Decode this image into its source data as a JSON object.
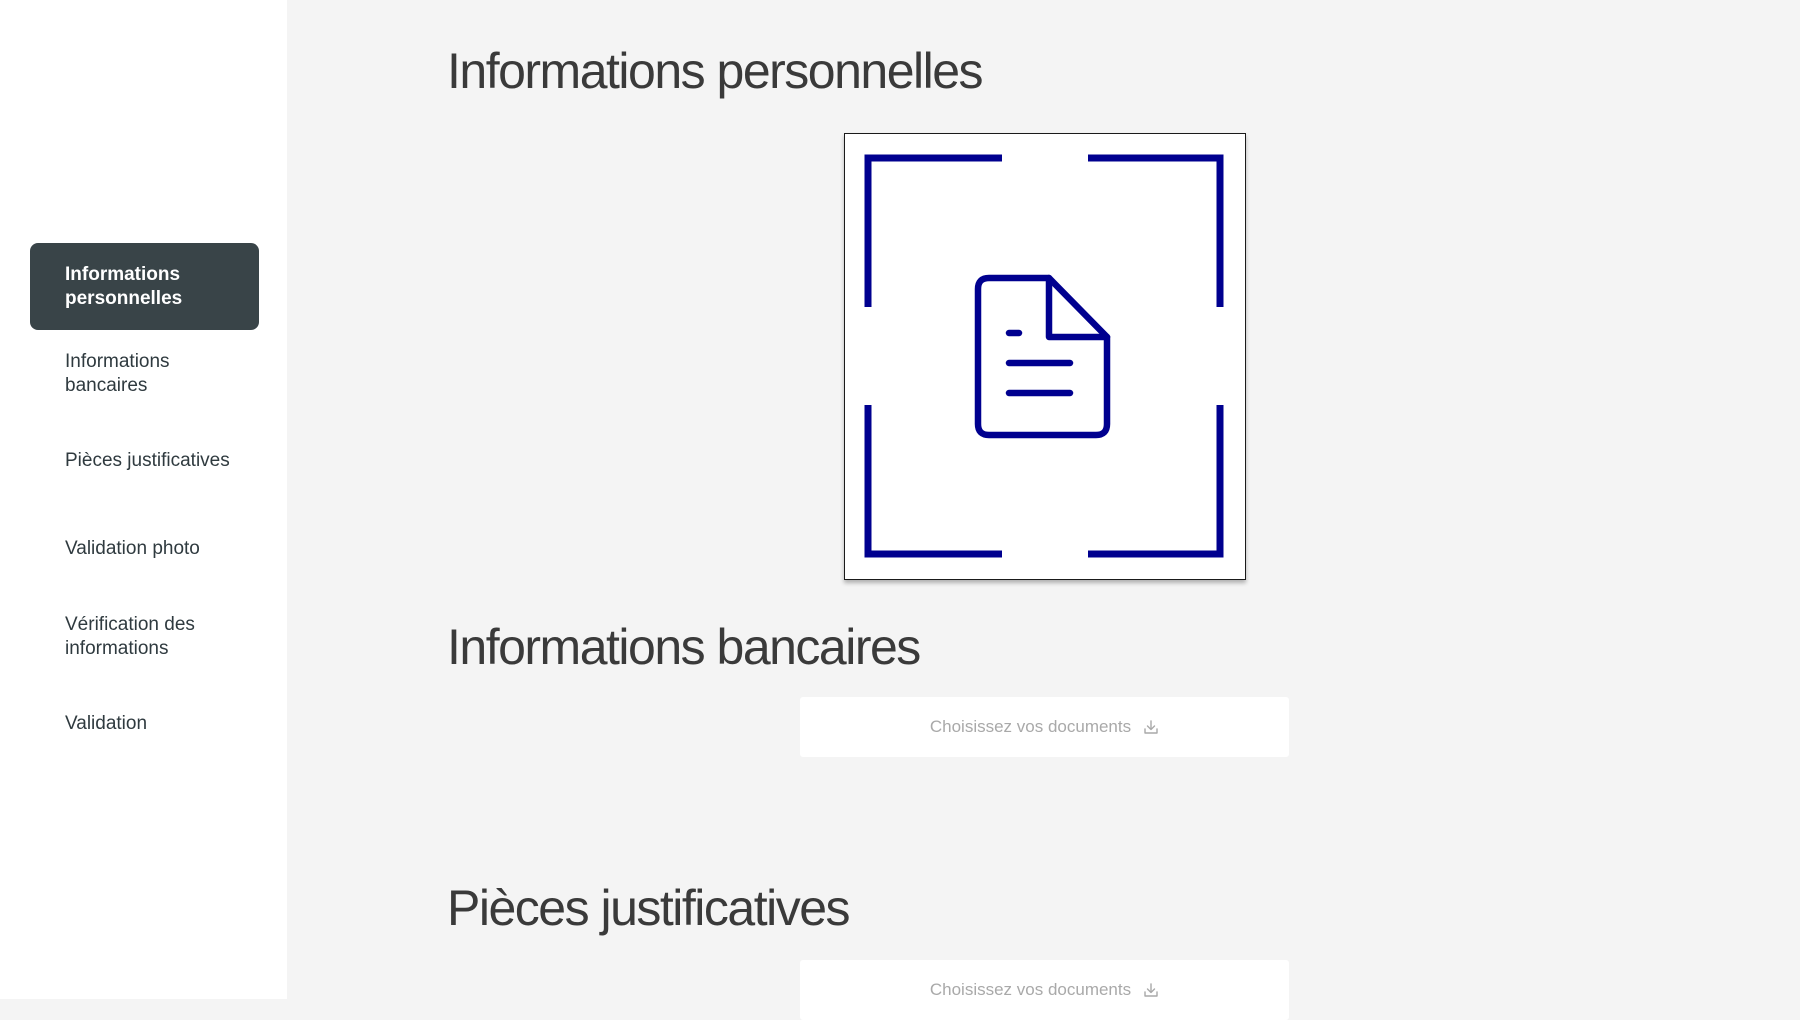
{
  "sidebar": {
    "items": [
      {
        "label": "Informations personnelles",
        "active": true
      },
      {
        "label": "Informations bancaires",
        "active": false
      },
      {
        "label": "Pièces justificatives",
        "active": false
      },
      {
        "label": "Validation photo",
        "active": false
      },
      {
        "label": "Vérification des informations",
        "active": false
      },
      {
        "label": "Validation",
        "active": false
      }
    ]
  },
  "sections": [
    {
      "title": "Informations personnelles",
      "content": "document-scanner"
    },
    {
      "title": "Informations bancaires",
      "picker_label": "Choisissez vos documents",
      "picker_icon": "download-icon"
    },
    {
      "title": "Pièces justificatives",
      "picker_label": "Choisissez vos documents",
      "picker_icon": "download-icon"
    }
  ],
  "scanner": {
    "icon": "document-icon",
    "frame_icon": "scan-frame-icon"
  },
  "colors": {
    "accent": "#00008f",
    "sidebar_active_bg": "#394448",
    "sidebar_bg": "#ffffff",
    "page_bg": "#f4f4f4",
    "picker_text": "#a9a9a9"
  }
}
